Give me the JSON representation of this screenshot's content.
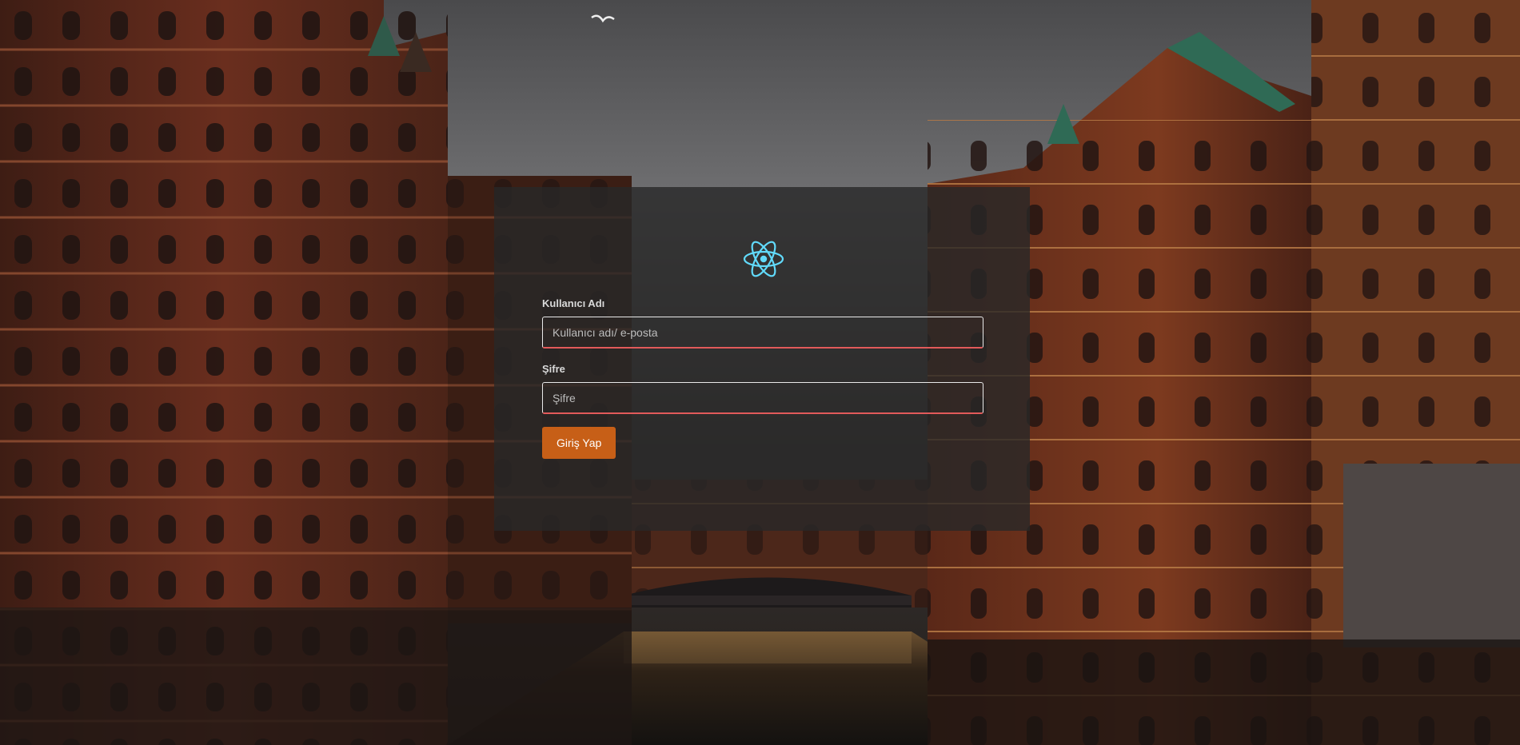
{
  "background": {
    "description_icon": "canal-warehouse-photo"
  },
  "logo": {
    "icon": "react-atom-icon",
    "color": "#61dafb"
  },
  "form": {
    "username_label": "Kullanıcı Adı",
    "username_placeholder": "Kullanıcı adı/ e-posta",
    "username_value": "",
    "password_label": "Şifre",
    "password_placeholder": "Şifre",
    "password_value": "",
    "submit_label": "Giriş Yap"
  },
  "colors": {
    "panel": "#282828",
    "button": "#c75f17",
    "input_accent": "#e25a5a"
  }
}
